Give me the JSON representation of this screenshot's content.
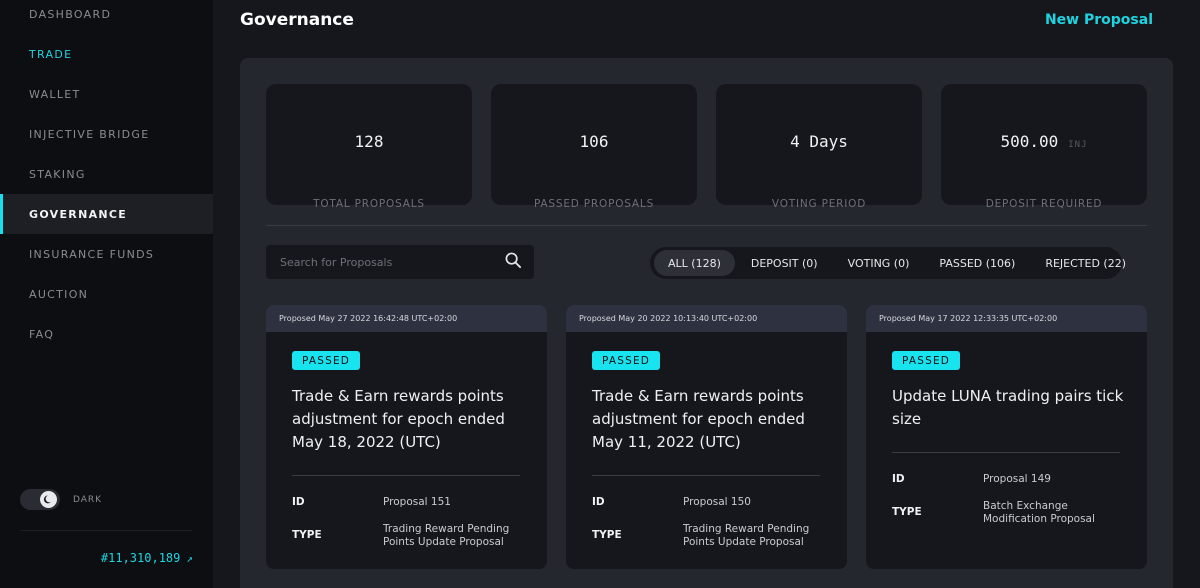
{
  "sidebar": {
    "items": [
      {
        "label": "DASHBOARD"
      },
      {
        "label": "TRADE"
      },
      {
        "label": "WALLET"
      },
      {
        "label": "INJECTIVE BRIDGE"
      },
      {
        "label": "STAKING"
      },
      {
        "label": "GOVERNANCE"
      },
      {
        "label": "INSURANCE FUNDS"
      },
      {
        "label": "AUCTION"
      },
      {
        "label": "FAQ"
      }
    ],
    "active_index": 5,
    "accent_index": 1,
    "theme_label": "DARK",
    "block_number": "#11,310,189",
    "block_link_icon": "arrow-up-right-icon"
  },
  "header": {
    "title": "Governance",
    "new_proposal_label": "New Proposal"
  },
  "stats": [
    {
      "value": "128",
      "unit": "",
      "label": "TOTAL PROPOSALS"
    },
    {
      "value": "106",
      "unit": "",
      "label": "PASSED PROPOSALS"
    },
    {
      "value": "4 Days",
      "unit": "",
      "label": "VOTING PERIOD"
    },
    {
      "value": "500.00",
      "unit": "INJ",
      "label": "DEPOSIT REQUIRED"
    }
  ],
  "search": {
    "placeholder": "Search for Proposals",
    "icon": "search-icon"
  },
  "filters": [
    {
      "label": "ALL (128)",
      "active": true
    },
    {
      "label": "DEPOSIT (0)",
      "active": false
    },
    {
      "label": "VOTING (0)",
      "active": false
    },
    {
      "label": "PASSED (106)",
      "active": false
    },
    {
      "label": "REJECTED (22)",
      "active": false
    }
  ],
  "proposals": [
    {
      "proposed": "Proposed May 27 2022 16:42:48 UTC+02:00",
      "status": "PASSED",
      "title": "Trade & Earn rewards points adjustment for epoch ended May 18, 2022 (UTC)",
      "id_label": "ID",
      "id_value": "Proposal 151",
      "type_label": "TYPE",
      "type_value": "Trading Reward Pending Points Update Proposal"
    },
    {
      "proposed": "Proposed May 20 2022 10:13:40 UTC+02:00",
      "status": "PASSED",
      "title": "Trade & Earn rewards points adjustment for epoch ended May 11, 2022 (UTC)",
      "id_label": "ID",
      "id_value": "Proposal 150",
      "type_label": "TYPE",
      "type_value": "Trading Reward Pending Points Update Proposal"
    },
    {
      "proposed": "Proposed May 17 2022 12:33:35 UTC+02:00",
      "status": "PASSED",
      "title": "Update LUNA trading pairs tick size",
      "id_label": "ID",
      "id_value": "Proposal 149",
      "type_label": "TYPE",
      "type_value": "Batch Exchange Modification Proposal"
    }
  ],
  "colors": {
    "accent": "#1ed4e0",
    "badge": "#17e4ef",
    "background": "#16171c",
    "panel": "#25272e"
  }
}
